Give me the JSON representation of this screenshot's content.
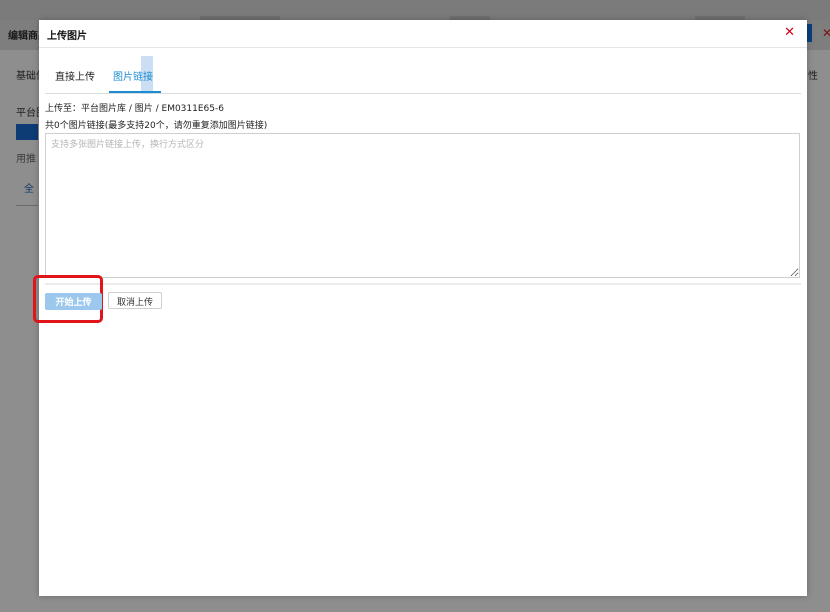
{
  "background": {
    "title": "编辑商品",
    "tab_basic": "基础信",
    "tab_right": "性",
    "label_platform": "平台图",
    "note": "用推"
  },
  "modal": {
    "title": "上传图片",
    "close_icon": "close-icon",
    "tabs": [
      {
        "label": "直接上传"
      },
      {
        "label": "图片链接"
      }
    ],
    "upload_path": "上传至：平台图片库 / 图片 / EM0311E65-6",
    "link_count": "共0个图片链接(最多支持20个，请勿重复添加图片链接)",
    "textarea_placeholder": "支持多张图片链接上传，换行方式区分",
    "start_upload_label": "开始上传",
    "cancel_upload_label": "取消上传"
  },
  "colors": {
    "accent": "#1a8ccf",
    "close": "#d0021b",
    "highlight_box": "#e0151a",
    "start_button": "#9cc8ee"
  }
}
